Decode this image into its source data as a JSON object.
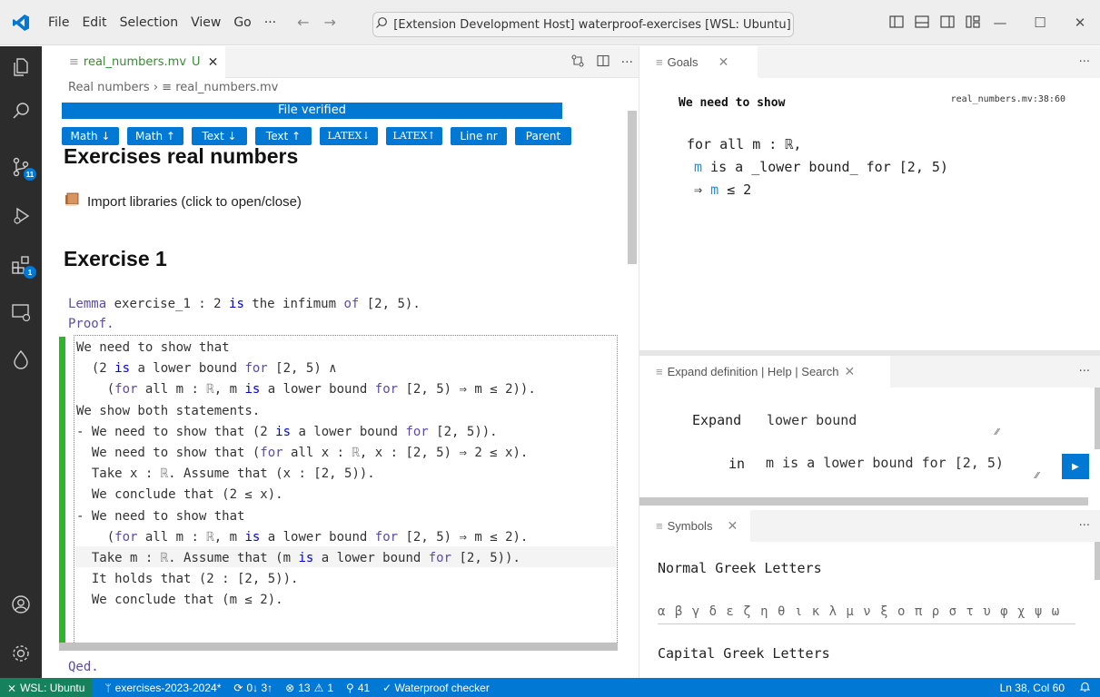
{
  "titlebar": {
    "menu": [
      "File",
      "Edit",
      "Selection",
      "View",
      "Go",
      "···"
    ],
    "back": "←",
    "forward": "→",
    "command_center": "[Extension Development Host] waterproof-exercises [WSL: Ubuntu]",
    "win_minimize": "—",
    "win_restore": "☐",
    "win_close": "✕"
  },
  "activity": {
    "source_control_badge": "11",
    "extensions_badge": "1"
  },
  "editor": {
    "tab_icon": "≡",
    "tab_label": "real_numbers.mv",
    "tab_modified": "U",
    "tab_close": "✕",
    "action_dots": "···",
    "breadcrumb_1": "Real numbers",
    "breadcrumb_sep": "›",
    "breadcrumb_icon": "≡",
    "breadcrumb_2": "real_numbers.mv",
    "verified": "File verified",
    "toolbar": [
      "Math ↓",
      "Math ↑",
      "Text ↓",
      "Text ↑",
      "LATEX↓",
      "LATEX↑",
      "Line nr",
      "Parent"
    ],
    "heading": "Exercises real numbers",
    "import_text": "Import libraries (click to open/close)",
    "exercise_heading": "Exercise 1",
    "lemma_kw": "Lemma",
    "lemma_a": " exercise_1 : 2 ",
    "lemma_is": "is",
    "lemma_b": " the infimum ",
    "lemma_of": "of",
    "lemma_c": " [2, 5).",
    "proof": "Proof.",
    "qed": "Qed."
  },
  "goals": {
    "tab_icon": "≡",
    "tab_label": "Goals",
    "tab_close": "✕",
    "dots": "···",
    "heading": "We need to show",
    "location": "real_numbers.mv:38:60",
    "line1": "for all m : ℝ,",
    "line2_var": "m",
    "line2_rest": " is a _lower bound_ for [2, 5)",
    "line3_arrow": "⇒ ",
    "line3_var": "m",
    "line3_rest": " ≤ 2"
  },
  "expand": {
    "tab_icon": "≡",
    "tab_label": "Expand definition | Help | Search",
    "tab_close": "✕",
    "dots": "···",
    "expand_label": "Expand",
    "expand_value": "lower bound",
    "in_label": "in",
    "in_value": "m is a lower bound for [2, 5)",
    "run_button": "▶"
  },
  "symbols": {
    "tab_icon": "≡",
    "tab_label": "Symbols",
    "tab_close": "✕",
    "dots": "···",
    "normal_heading": "Normal Greek Letters",
    "normal_letters": "α β γ δ ε ζ η θ ι κ λ μ ν ξ ο π ρ σ τ υ φ χ ψ ω",
    "capital_heading": "Capital Greek Letters"
  },
  "statusbar": {
    "remote": "WSL: Ubuntu",
    "branch": "exercises-2023-2024*",
    "sync": "0↓ 3↑",
    "errors": "13",
    "warnings": "1",
    "ports": "41",
    "checker": "✓ Waterproof checker",
    "position": "Ln 38, Col 60"
  }
}
